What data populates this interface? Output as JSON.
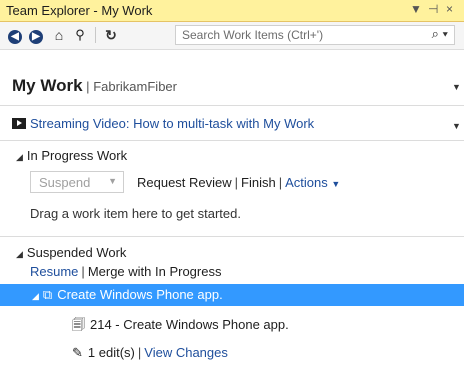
{
  "window": {
    "title": "Team Explorer - My Work",
    "controls": {
      "dropdown": "▼",
      "pin": "⊣",
      "close": "×"
    }
  },
  "toolbar": {
    "search_placeholder": "Search Work Items (Ctrl+')",
    "search_icon": "⌕",
    "search_dropdown": "▾"
  },
  "header": {
    "title": "My Work",
    "separator": "|",
    "project": "FabrikamFiber"
  },
  "video": {
    "link": "Streaming Video: How to multi-task with My Work"
  },
  "in_progress": {
    "title": "In Progress Work",
    "suspend_label": "Suspend",
    "request_review": "Request Review",
    "finish": "Finish",
    "actions": "Actions",
    "hint": "Drag a work item here to get started."
  },
  "suspended": {
    "title": "Suspended Work",
    "resume": "Resume",
    "merge": "Merge with In Progress",
    "item_title": "Create Windows Phone app.",
    "work_item": "214 - Create Windows Phone app.",
    "edits": "1 edit(s)",
    "view_changes": "View Changes"
  }
}
